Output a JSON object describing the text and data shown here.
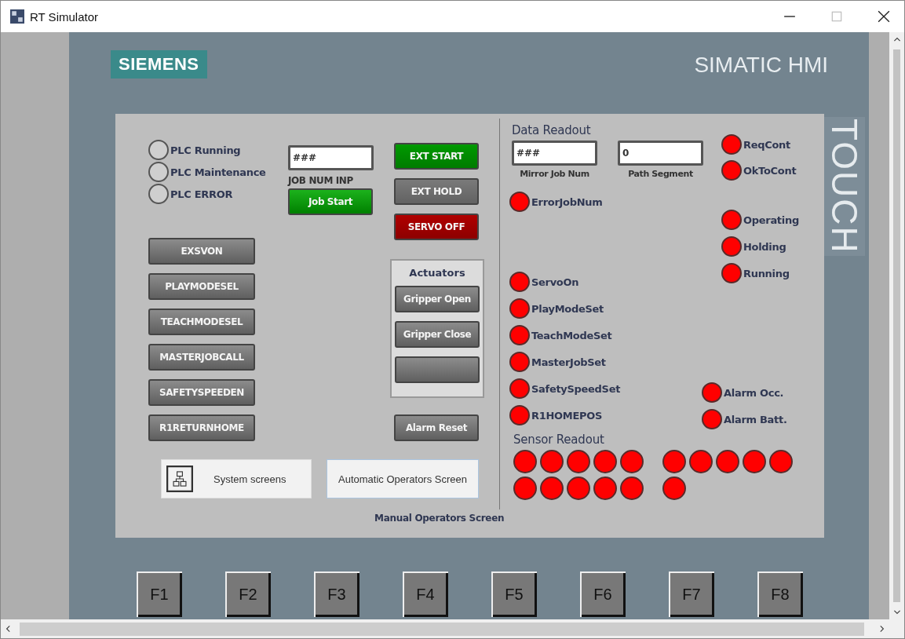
{
  "window": {
    "title": "RT Simulator"
  },
  "header": {
    "logo": "SIEMENS",
    "product": "SIMATIC HMI",
    "touch_label": "TOUCH"
  },
  "plc_status": [
    {
      "label": "PLC Running",
      "on": false
    },
    {
      "label": "PLC Maintenance",
      "on": false
    },
    {
      "label": "PLC ERROR",
      "on": false
    }
  ],
  "job_input": {
    "value": "###",
    "label": "JOB NUM INP",
    "button": "Job Start"
  },
  "ext_buttons": [
    {
      "label": "EXT START",
      "color": "#009a00"
    },
    {
      "label": "EXT HOLD",
      "color": "#7a7a7a"
    },
    {
      "label": "SERVO OFF",
      "color": "#b00000"
    }
  ],
  "mode_buttons": [
    "EXSVON",
    "PLAYMODESEL",
    "TEACHMODESEL",
    "MASTERJOBCALL",
    "SAFETYSPEEDEN",
    "R1RETURNHOME"
  ],
  "actuators": {
    "title": "Actuators",
    "buttons": [
      {
        "kind": "labeled",
        "label": "Gripper Open"
      },
      {
        "kind": "labeled",
        "label": "Gripper Close"
      },
      {
        "kind": "blank"
      }
    ]
  },
  "alarm_reset": "Alarm Reset",
  "nav_buttons": [
    {
      "kind": "icon",
      "label": "System screens"
    },
    {
      "kind": "plain",
      "label": "Automatic Operators Screen"
    }
  ],
  "screen_name": "Manual Operators Screen",
  "data_readout": {
    "title": "Data Readout",
    "fields": [
      {
        "value": "###",
        "label": "Mirror Job Num"
      },
      {
        "value": "0",
        "label": "Path Segment"
      }
    ]
  },
  "error_lamp": {
    "label": "ErrorJobNum",
    "on": true
  },
  "handshake_lamps": [
    {
      "label": "ReqCont",
      "on": true
    },
    {
      "label": "OkToCont",
      "on": true
    }
  ],
  "state_lamps": [
    {
      "label": "Operating",
      "on": true
    },
    {
      "label": "Holding",
      "on": true
    },
    {
      "label": "Running",
      "on": true
    }
  ],
  "mode_lamps": [
    {
      "label": "ServoOn",
      "on": true
    },
    {
      "label": "PlayModeSet",
      "on": true
    },
    {
      "label": "TeachModeSet",
      "on": true
    },
    {
      "label": "MasterJobSet",
      "on": true
    },
    {
      "label": "SafetySpeedSet",
      "on": true
    },
    {
      "label": "R1HOMEPOS",
      "on": true
    }
  ],
  "alarm_lamps": [
    {
      "label": "Alarm Occ.",
      "on": true
    },
    {
      "label": "Alarm Batt.",
      "on": true
    }
  ],
  "sensor_readout": {
    "title": "Sensor Readout",
    "groups": [
      [
        {
          "on": true
        },
        {
          "on": true
        },
        {
          "on": true
        },
        {
          "on": true
        },
        {
          "on": true
        },
        {
          "on": true
        },
        {
          "on": true
        },
        {
          "on": true
        },
        {
          "on": true
        },
        {
          "on": true
        }
      ],
      [
        {
          "on": true
        },
        {
          "on": true
        },
        {
          "on": true
        },
        {
          "on": true
        },
        {
          "on": true
        },
        {
          "on": true
        }
      ]
    ]
  },
  "function_keys": [
    "F1",
    "F2",
    "F3",
    "F4",
    "F5",
    "F6",
    "F7",
    "F8"
  ]
}
